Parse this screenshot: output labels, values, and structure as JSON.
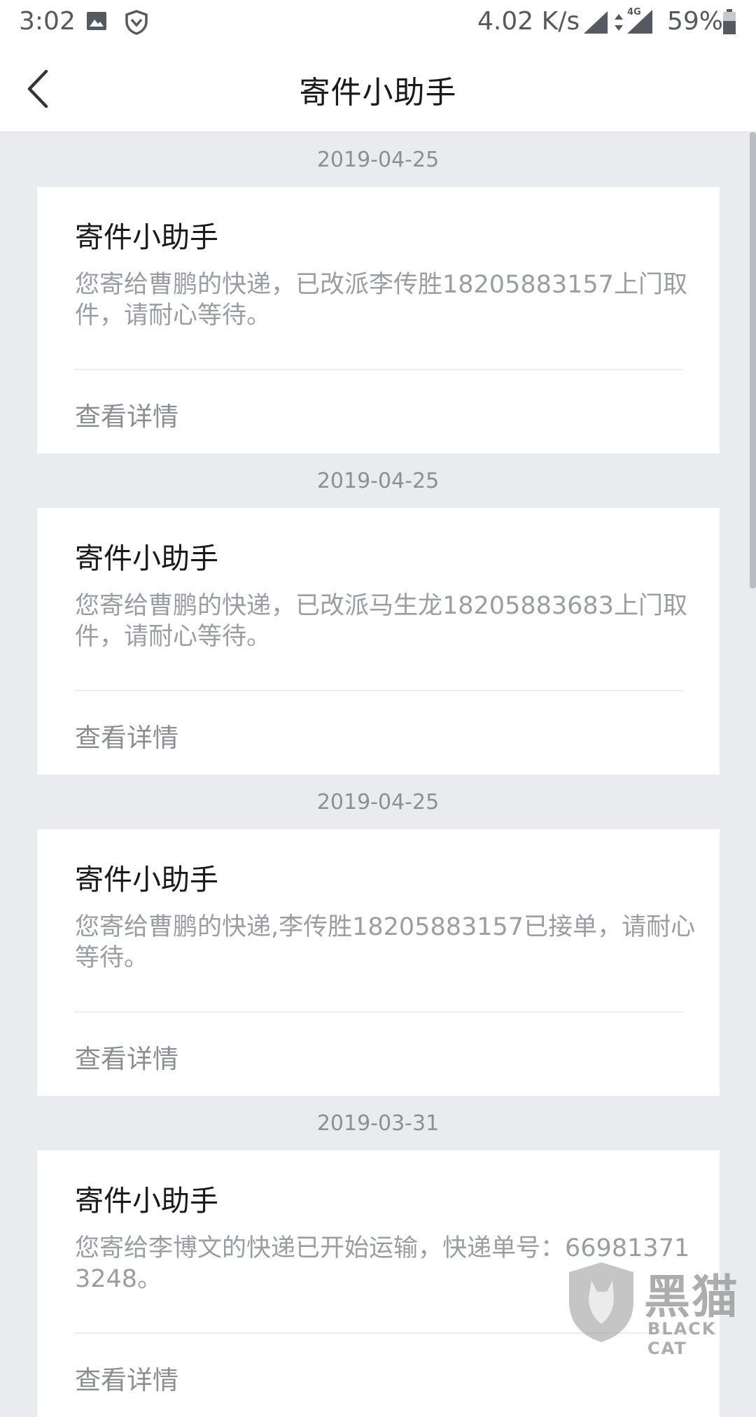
{
  "status_bar": {
    "time": "3:02",
    "network_speed": "4.02 K/s",
    "network_type": "4G",
    "battery": "59%",
    "icons": [
      "image-icon",
      "shield-icon",
      "signal-icon",
      "data-arrows-icon",
      "signal-4g-icon",
      "battery-icon"
    ]
  },
  "header": {
    "title": "寄件小助手",
    "back_icon": "chevron-left-icon"
  },
  "messages": [
    {
      "date": "2019-04-25",
      "title": "寄件小助手",
      "body": "您寄给曹鹏的快递，已改派李传胜18205883157上门取件，请耐心等待。",
      "link": "查看详情"
    },
    {
      "date": "2019-04-25",
      "title": "寄件小助手",
      "body": "您寄给曹鹏的快递，已改派马生龙18205883683上门取件，请耐心等待。",
      "link": "查看详情"
    },
    {
      "date": "2019-04-25",
      "title": "寄件小助手",
      "body": "您寄给曹鹏的快递,李传胜18205883157已接单，请耐心等待。",
      "link": "查看详情"
    },
    {
      "date": "2019-03-31",
      "title": "寄件小助手",
      "body": "您寄给李博文的快递已开始运输，快递单号：669813713248。",
      "link": "查看详情"
    }
  ],
  "watermark": {
    "text_cn": "黑猫",
    "text_en": "BLACK CAT"
  },
  "colors": {
    "page_background": "#e9ebee",
    "card_background": "#ffffff",
    "title_text": "#1a1a1a",
    "body_text": "#9a9ea3"
  }
}
